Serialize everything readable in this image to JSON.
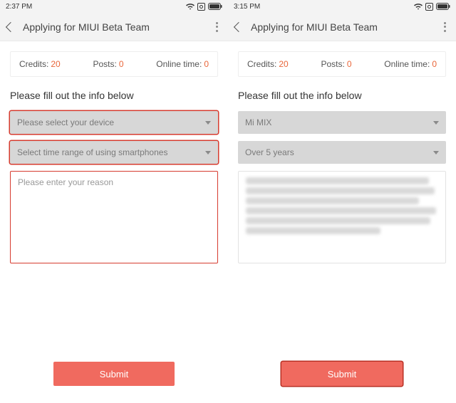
{
  "left": {
    "status_time": "2:37 PM",
    "title": "Applying for MIUI Beta Team",
    "stats": {
      "credits_label": "Credits:",
      "credits_value": "20",
      "posts_label": "Posts:",
      "posts_value": "0",
      "online_label": "Online time:",
      "online_value": "0"
    },
    "prompt": "Please fill out the info below",
    "device_select": "Please select your device",
    "time_select": "Select time range of using smartphones",
    "reason_placeholder": "Please enter your reason",
    "submit_label": "Submit"
  },
  "right": {
    "status_time": "3:15 PM",
    "title": "Applying for MIUI Beta Team",
    "stats": {
      "credits_label": "Credits:",
      "credits_value": "20",
      "posts_label": "Posts:",
      "posts_value": "0",
      "online_label": "Online time:",
      "online_value": "0"
    },
    "prompt": "Please fill out the info below",
    "device_select": "Mi MIX",
    "time_select": "Over 5 years",
    "reason_value": "(blurred text content)",
    "submit_label": "Submit"
  }
}
